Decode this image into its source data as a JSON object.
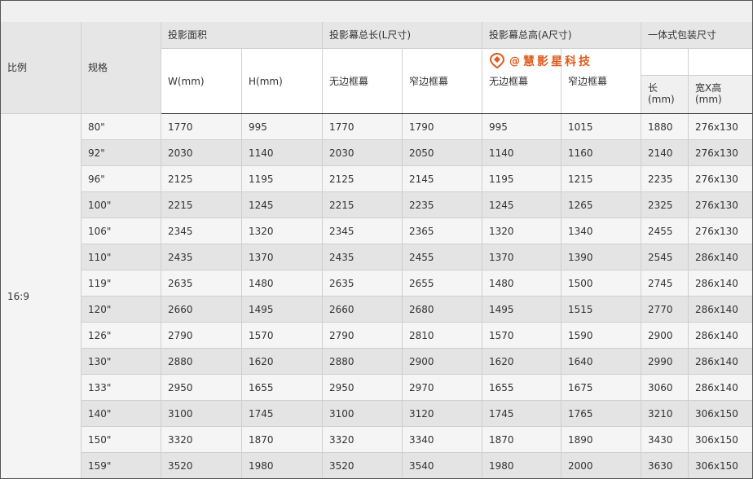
{
  "columns": {
    "ratio": "比例",
    "spec": "规格",
    "area": "投影面积",
    "w": "W(mm)",
    "h": "H(mm)",
    "total_length": "投影幕总长(L尺寸)",
    "total_height": "投影幕总高(A尺寸)",
    "borderless": "无边框幕",
    "narrow": "窄边框幕",
    "package": "一体式包装尺寸",
    "pkg_length": "长\n(mm)",
    "pkg_wh": "宽X高\n(mm)"
  },
  "watermark": {
    "at": "@",
    "text": "慧影星科技",
    "accent": "#e05a1c"
  },
  "ratio_value": "16:9",
  "rows": [
    [
      "80\"",
      "1770",
      "995",
      "1770",
      "1790",
      "995",
      "1015",
      "1880",
      "276x130"
    ],
    [
      "92\"",
      "2030",
      "1140",
      "2030",
      "2050",
      "1140",
      "1160",
      "2140",
      "276x130"
    ],
    [
      "96\"",
      "2125",
      "1195",
      "2125",
      "2145",
      "1195",
      "1215",
      "2235",
      "276x130"
    ],
    [
      "100\"",
      "2215",
      "1245",
      "2215",
      "2235",
      "1245",
      "1265",
      "2325",
      "276x130"
    ],
    [
      "106\"",
      "2345",
      "1320",
      "2345",
      "2365",
      "1320",
      "1340",
      "2455",
      "276x130"
    ],
    [
      "110\"",
      "2435",
      "1370",
      "2435",
      "2455",
      "1370",
      "1390",
      "2545",
      "286x140"
    ],
    [
      "119\"",
      "2635",
      "1480",
      "2635",
      "2655",
      "1480",
      "1500",
      "2745",
      "286x140"
    ],
    [
      "120\"",
      "2660",
      "1495",
      "2660",
      "2680",
      "1495",
      "1515",
      "2770",
      "286x140"
    ],
    [
      "126\"",
      "2790",
      "1570",
      "2790",
      "2810",
      "1570",
      "1590",
      "2900",
      "286x140"
    ],
    [
      "130\"",
      "2880",
      "1620",
      "2880",
      "2900",
      "1620",
      "1640",
      "2990",
      "286x140"
    ],
    [
      "133\"",
      "2950",
      "1655",
      "2950",
      "2970",
      "1655",
      "1675",
      "3060",
      "286x140"
    ],
    [
      "140\"",
      "3100",
      "1745",
      "3100",
      "3120",
      "1745",
      "1765",
      "3210",
      "306x150"
    ],
    [
      "150\"",
      "3320",
      "1870",
      "3320",
      "3340",
      "1870",
      "1890",
      "3430",
      "306x150"
    ],
    [
      "159\"",
      "3520",
      "1980",
      "3520",
      "3540",
      "1980",
      "2000",
      "3630",
      "306x150"
    ]
  ]
}
